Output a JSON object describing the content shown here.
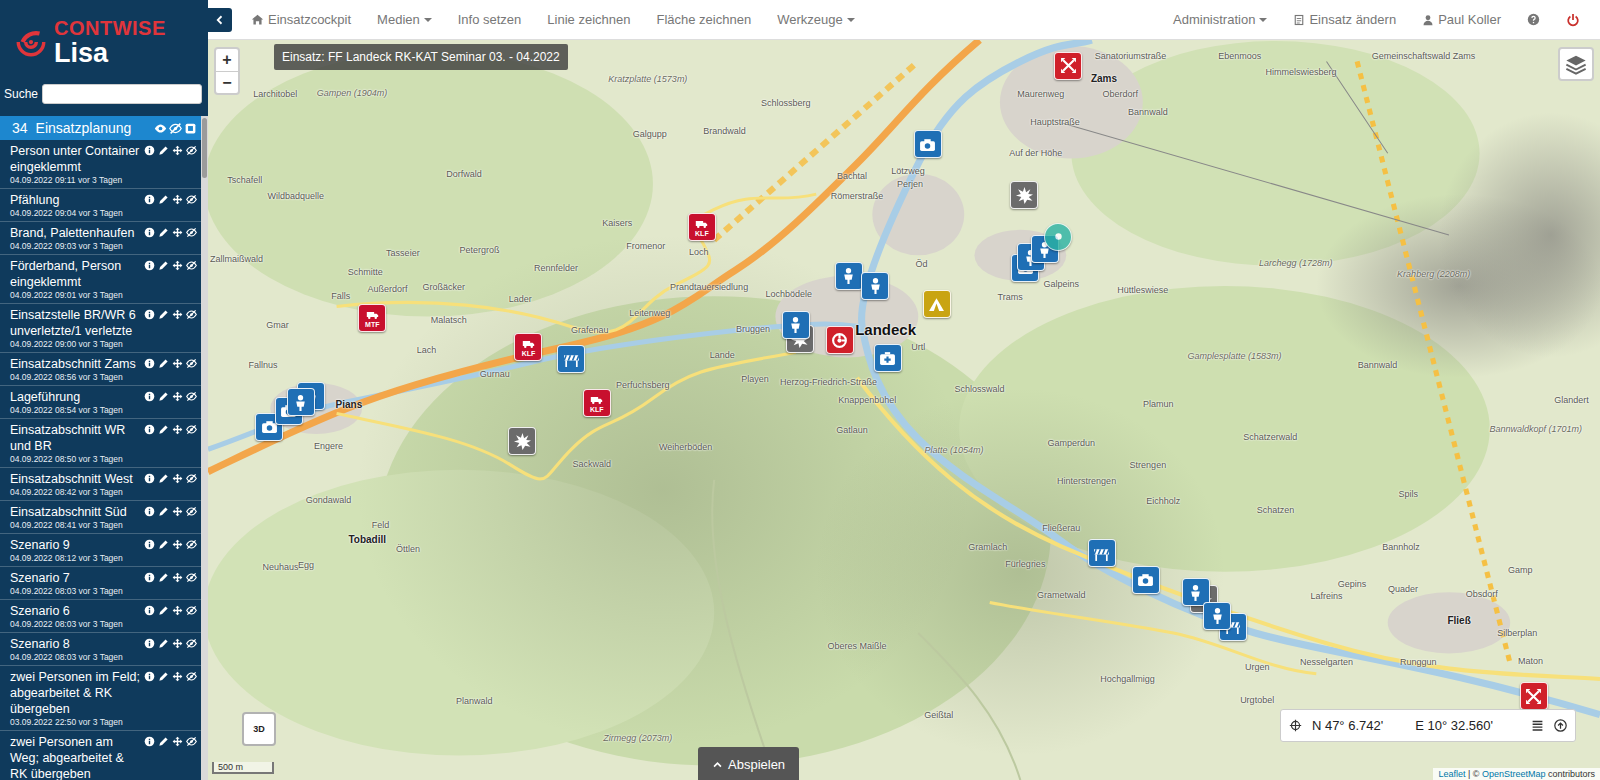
{
  "logo": {
    "brand": "CONTWISE",
    "product": "Lisa"
  },
  "search": {
    "label": "Suche",
    "value": ""
  },
  "list_header": {
    "count": "34",
    "title": "Einsatzplanung"
  },
  "sidebar_items": [
    {
      "title": "Person unter Container eingeklemmt",
      "date": "04.09.2022 09:11 vor 3 Tagen"
    },
    {
      "title": "Pfählung",
      "date": "04.09.2022 09:04 vor 3 Tagen"
    },
    {
      "title": "Brand, Palettenhaufen",
      "date": "04.09.2022 09:03 vor 3 Tagen"
    },
    {
      "title": "Förderband, Person eingeklemmt",
      "date": "04.09.2022 09:01 vor 3 Tagen"
    },
    {
      "title": "Einsatzstelle BR/WR 6 unverletzte/1 verletzte",
      "date": "04.09.2022 09:00 vor 3 Tagen"
    },
    {
      "title": "Einsatzabschnitt Zams",
      "date": "04.09.2022 08:56 vor 3 Tagen"
    },
    {
      "title": "Lageführung",
      "date": "04.09.2022 08:54 vor 3 Tagen"
    },
    {
      "title": "Einsatzabschnitt WR und BR",
      "date": "04.09.2022 08:50 vor 3 Tagen"
    },
    {
      "title": "Einsatzabschnitt West",
      "date": "04.09.2022 08:42 vor 3 Tagen"
    },
    {
      "title": "Einsatzabschnitt Süd",
      "date": "04.09.2022 08:41 vor 3 Tagen"
    },
    {
      "title": "Szenario 9",
      "date": "04.09.2022 08:12 vor 3 Tagen"
    },
    {
      "title": "Szenario 7",
      "date": "04.09.2022 08:03 vor 3 Tagen"
    },
    {
      "title": "Szenario 6",
      "date": "04.09.2022 08:03 vor 3 Tagen"
    },
    {
      "title": "Szenario 8",
      "date": "04.09.2022 08:03 vor 3 Tagen"
    },
    {
      "title": "zwei Personen im Feld; abgearbeitet & RK übergeben",
      "date": "03.09.2022 22:50 vor 3 Tagen"
    },
    {
      "title": "zwei Personen am Weg; abgearbeitet & RK übergeben",
      "date": ""
    }
  ],
  "nav_left": [
    {
      "label": "Einsatzcockpit",
      "kind": "link"
    },
    {
      "label": "Medien",
      "kind": "dropdown"
    },
    {
      "label": "Info setzen",
      "kind": "link"
    },
    {
      "label": "Linie zeichnen",
      "kind": "link"
    },
    {
      "label": "Fläche zeichnen",
      "kind": "link"
    },
    {
      "label": "Werkzeuge",
      "kind": "dropdown"
    }
  ],
  "nav_right": [
    {
      "label": "Administration",
      "kind": "dropdown"
    },
    {
      "label": "Einsatz ändern",
      "kind": "link"
    },
    {
      "label": "Paul Koller",
      "kind": "link"
    }
  ],
  "map": {
    "title": "Einsatz: FF Landeck RK-KAT Seminar 03. - 04.2022",
    "zoom_in": "+",
    "zoom_out": "−",
    "view_toggle": "3D",
    "play_button": "Abspielen",
    "scale": "500 m",
    "coords": {
      "lat": "N 47° 6.742'",
      "lon": "E 10° 32.560'"
    },
    "attribution": {
      "leaflet": "Leaflet",
      "middle": " | © ",
      "osm": "OpenStreetMap",
      "suffix": " contributors"
    },
    "labels": [
      {
        "text": "Kratzplatte (1573m)",
        "kind": "peak"
      },
      {
        "text": "Gampen (1904m)",
        "kind": "peak"
      },
      {
        "text": "Larchitobel",
        "kind": "place"
      },
      {
        "text": "Schlossberg",
        "kind": "place"
      },
      {
        "text": "Brandwald",
        "kind": "place"
      },
      {
        "text": "Galgupp",
        "kind": "place"
      },
      {
        "text": "Sanatoriumstraße",
        "kind": "place"
      },
      {
        "text": "Zams",
        "kind": "town"
      },
      {
        "text": "Maurenweg",
        "kind": "place"
      },
      {
        "text": "Oberdorf",
        "kind": "place"
      },
      {
        "text": "Hauptstraße",
        "kind": "place"
      },
      {
        "text": "Auf der Höhe",
        "kind": "place"
      },
      {
        "text": "Ebenmoos",
        "kind": "place"
      },
      {
        "text": "Himmelswiesberg",
        "kind": "place"
      },
      {
        "text": "Gemeinschaftswald Zams",
        "kind": "place"
      },
      {
        "text": "Bannwald",
        "kind": "place"
      },
      {
        "text": "Lötzweg",
        "kind": "place"
      },
      {
        "text": "Bachtal",
        "kind": "place"
      },
      {
        "text": "Perjen",
        "kind": "place"
      },
      {
        "text": "Römerstraße",
        "kind": "place"
      },
      {
        "text": "Wildbadquelle",
        "kind": "place"
      },
      {
        "text": "Tschafell",
        "kind": "place"
      },
      {
        "text": "Dorfwald",
        "kind": "place"
      },
      {
        "text": "Kaisers",
        "kind": "place"
      },
      {
        "text": "Loch",
        "kind": "place"
      },
      {
        "text": "Fromenor",
        "kind": "place"
      },
      {
        "text": "Tasseier",
        "kind": "place"
      },
      {
        "text": "Schmitte",
        "kind": "place"
      },
      {
        "text": "Außerdorf",
        "kind": "place"
      },
      {
        "text": "Falls",
        "kind": "place"
      },
      {
        "text": "Großäcker",
        "kind": "place"
      },
      {
        "text": "Petergroß",
        "kind": "place"
      },
      {
        "text": "Rennfelder",
        "kind": "place"
      },
      {
        "text": "Lader",
        "kind": "place"
      },
      {
        "text": "Prandtauersiedlung",
        "kind": "place"
      },
      {
        "text": "Lochbödele",
        "kind": "place"
      },
      {
        "text": "Leitenweg",
        "kind": "place"
      },
      {
        "text": "Grafenau",
        "kind": "place"
      },
      {
        "text": "Malatsch",
        "kind": "place"
      },
      {
        "text": "Gurnau",
        "kind": "place"
      },
      {
        "text": "Lach",
        "kind": "place"
      },
      {
        "text": "Gmar",
        "kind": "place"
      },
      {
        "text": "Fallnus",
        "kind": "place"
      },
      {
        "text": "Zallmaißwald",
        "kind": "place"
      },
      {
        "text": "Bruggen",
        "kind": "place"
      },
      {
        "text": "Landeck",
        "kind": "city"
      },
      {
        "text": "Öd",
        "kind": "place"
      },
      {
        "text": "Trams",
        "kind": "place"
      },
      {
        "text": "Galpeins",
        "kind": "place"
      },
      {
        "text": "Hüttleswiese",
        "kind": "place"
      },
      {
        "text": "Larchegg (1728m)",
        "kind": "peak"
      },
      {
        "text": "Krahberg (2208m)",
        "kind": "peak"
      },
      {
        "text": "Perfuchsberg",
        "kind": "place"
      },
      {
        "text": "Lande",
        "kind": "place"
      },
      {
        "text": "Playen",
        "kind": "place"
      },
      {
        "text": "Herzog-Friedrich-Straße",
        "kind": "place"
      },
      {
        "text": "Urtl",
        "kind": "place"
      },
      {
        "text": "Knappenbühel",
        "kind": "place"
      },
      {
        "text": "Schlosswald",
        "kind": "place"
      },
      {
        "text": "Gamplesplatte (1583m)",
        "kind": "peak"
      },
      {
        "text": "Bannwald",
        "kind": "place"
      },
      {
        "text": "Plamun",
        "kind": "place"
      },
      {
        "text": "Schatzerwald",
        "kind": "place"
      },
      {
        "text": "Weiherböden",
        "kind": "place"
      },
      {
        "text": "Sackwald",
        "kind": "place"
      },
      {
        "text": "Gatlaun",
        "kind": "place"
      },
      {
        "text": "Platte (1054m)",
        "kind": "peak"
      },
      {
        "text": "Gamperdun",
        "kind": "place"
      },
      {
        "text": "Hinterstrengen",
        "kind": "place"
      },
      {
        "text": "Strengen",
        "kind": "place"
      },
      {
        "text": "Eichholz",
        "kind": "place"
      },
      {
        "text": "Schatzen",
        "kind": "place"
      },
      {
        "text": "Spils",
        "kind": "place"
      },
      {
        "text": "Bannwaldkopf (1701m)",
        "kind": "peak"
      },
      {
        "text": "Glandert",
        "kind": "place"
      },
      {
        "text": "Engere",
        "kind": "place"
      },
      {
        "text": "Gondawald",
        "kind": "place"
      },
      {
        "text": "Tobadill",
        "kind": "town"
      },
      {
        "text": "Feld",
        "kind": "place"
      },
      {
        "text": "Öttlen",
        "kind": "place"
      },
      {
        "text": "Neuhaus",
        "kind": "place"
      },
      {
        "text": "Egg",
        "kind": "place"
      },
      {
        "text": "Pians",
        "kind": "town"
      },
      {
        "text": "Fließerau",
        "kind": "place"
      },
      {
        "text": "Gramlach",
        "kind": "place"
      },
      {
        "text": "Fürlegries",
        "kind": "place"
      },
      {
        "text": "Grametwald",
        "kind": "place"
      },
      {
        "text": "Lafreins",
        "kind": "place"
      },
      {
        "text": "Bannholz",
        "kind": "place"
      },
      {
        "text": "Gepins",
        "kind": "place"
      },
      {
        "text": "Quader",
        "kind": "place"
      },
      {
        "text": "Obsdorf",
        "kind": "place"
      },
      {
        "text": "Fließ",
        "kind": "town"
      },
      {
        "text": "Silberplan",
        "kind": "place"
      },
      {
        "text": "Gamp",
        "kind": "place"
      },
      {
        "text": "Maton",
        "kind": "place"
      },
      {
        "text": "Nesselgarten",
        "kind": "place"
      },
      {
        "text": "Runggun",
        "kind": "place"
      },
      {
        "text": "Urgen",
        "kind": "place"
      },
      {
        "text": "Urgtobel",
        "kind": "place"
      },
      {
        "text": "Hochgallmigg",
        "kind": "place"
      },
      {
        "text": "Oberes Maißle",
        "kind": "place"
      },
      {
        "text": "Planwald",
        "kind": "place"
      },
      {
        "text": "Geißtal",
        "kind": "place"
      },
      {
        "text": "Zirmegg (2073m)",
        "kind": "peak"
      }
    ],
    "pins": [
      {
        "kind": "vehicle",
        "color": "#c8102e",
        "label": "KLF"
      },
      {
        "kind": "vehicle",
        "color": "#c8102e",
        "label": "MTF"
      },
      {
        "kind": "vehicle",
        "color": "#c8102e",
        "label": "KLF"
      },
      {
        "kind": "vehicle",
        "color": "#c8102e",
        "label": "KLF"
      },
      {
        "kind": "hazard",
        "color": "#d0202a"
      },
      {
        "kind": "hazard",
        "color": "#d0202a"
      },
      {
        "kind": "camera",
        "color": "#1f6fb5"
      },
      {
        "kind": "camera",
        "color": "#1f6fb5"
      },
      {
        "kind": "camera",
        "color": "#1f6fb5"
      },
      {
        "kind": "camera",
        "color": "#1f6fb5"
      },
      {
        "kind": "camera",
        "color": "#1f6fb5"
      },
      {
        "kind": "explosion",
        "color": "#6b6b6b"
      },
      {
        "kind": "explosion",
        "color": "#6b6b6b"
      },
      {
        "kind": "explosion",
        "color": "#6b6b6b"
      },
      {
        "kind": "explosion",
        "color": "#6b6b6b"
      },
      {
        "kind": "barrier",
        "color": "#1f6fb5"
      },
      {
        "kind": "barrier",
        "color": "#1f6fb5"
      },
      {
        "kind": "barrier",
        "color": "#1f6fb5"
      },
      {
        "kind": "unit",
        "color": "#1f6fb5"
      },
      {
        "kind": "unit",
        "color": "#1f6fb5"
      },
      {
        "kind": "unit",
        "color": "#1f6fb5"
      },
      {
        "kind": "pump",
        "color": "#d0202a"
      },
      {
        "kind": "medic",
        "color": "#1f6fb5"
      },
      {
        "kind": "tent",
        "color": "#c9a412"
      },
      {
        "kind": "unit",
        "color": "#1f6fb5"
      },
      {
        "kind": "unit",
        "color": "#1f6fb5"
      },
      {
        "kind": "circle",
        "color": "#2bb3a3"
      },
      {
        "kind": "unit",
        "color": "#1f6fb5"
      },
      {
        "kind": "unit",
        "color": "#1f6fb5"
      },
      {
        "kind": "unit",
        "color": "#1f6fb5"
      },
      {
        "kind": "unit",
        "color": "#1f6fb5"
      }
    ]
  }
}
